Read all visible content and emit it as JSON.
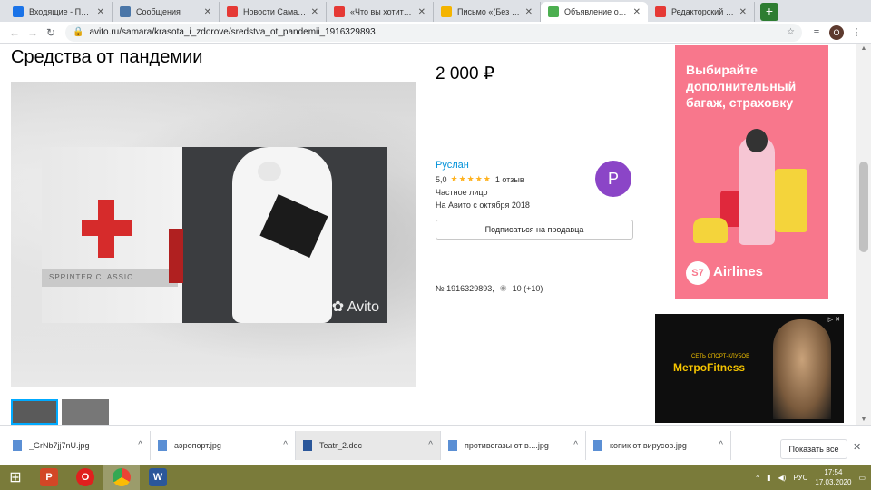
{
  "tabs": [
    {
      "title": "Входящие - Почта",
      "color": "#1a73e8",
      "active": false
    },
    {
      "title": "Сообщения",
      "color": "#4a76a8",
      "active": false
    },
    {
      "title": "Новости Самары",
      "color": "#e53935",
      "active": false
    },
    {
      "title": "«Что вы хотите - «",
      "color": "#e53935",
      "active": false
    },
    {
      "title": "Письмо «(Без темы",
      "color": "#f4b400",
      "active": false
    },
    {
      "title": "Объявление откл",
      "color": "#4caf50",
      "active": true
    },
    {
      "title": "Редакторский инт",
      "color": "#e53935",
      "active": false
    }
  ],
  "toolbar": {
    "url": "avito.ru/samara/krasota_i_zdorove/sredstva_ot_pandemii_1916329893",
    "profile_initial": "O"
  },
  "listing": {
    "title": "Средства от пандемии",
    "price": "2 000 ₽",
    "watermark": "Avito",
    "van_text": "SPRINTER CLASSIC"
  },
  "seller": {
    "name": "Руслан",
    "rating": "5,0",
    "stars": "★★★★★",
    "reviews": "1 отзыв",
    "type": "Частное лицо",
    "since": "На Авито с октября 2018",
    "avatar_initial": "P",
    "subscribe_label": "Подписаться на продавца"
  },
  "meta": {
    "id": "№ 1916329893,",
    "views": "10 (+10)"
  },
  "ads": {
    "ad1_text": "Выбирайте дополнительный багаж, страховку",
    "ad1_brand": "Airlines",
    "ad1_logo": "S7",
    "ad2_small": "СЕТЬ СПОРТ-КЛУБОВ",
    "ad2_logo": "МетроFitness"
  },
  "downloads": [
    {
      "name": "_GrNb7jj7nU.jpg",
      "highlight": false
    },
    {
      "name": "аэропорт.jpg",
      "highlight": false
    },
    {
      "name": "Teatr_2.doc",
      "highlight": true
    },
    {
      "name": "противогазы от в....jpg",
      "highlight": false
    },
    {
      "name": "копик от вирусов.jpg",
      "highlight": false
    }
  ],
  "download_show_all": "Показать все",
  "taskbar": {
    "lang": "РУС",
    "time": "17:54",
    "date": "17.03.2020"
  }
}
